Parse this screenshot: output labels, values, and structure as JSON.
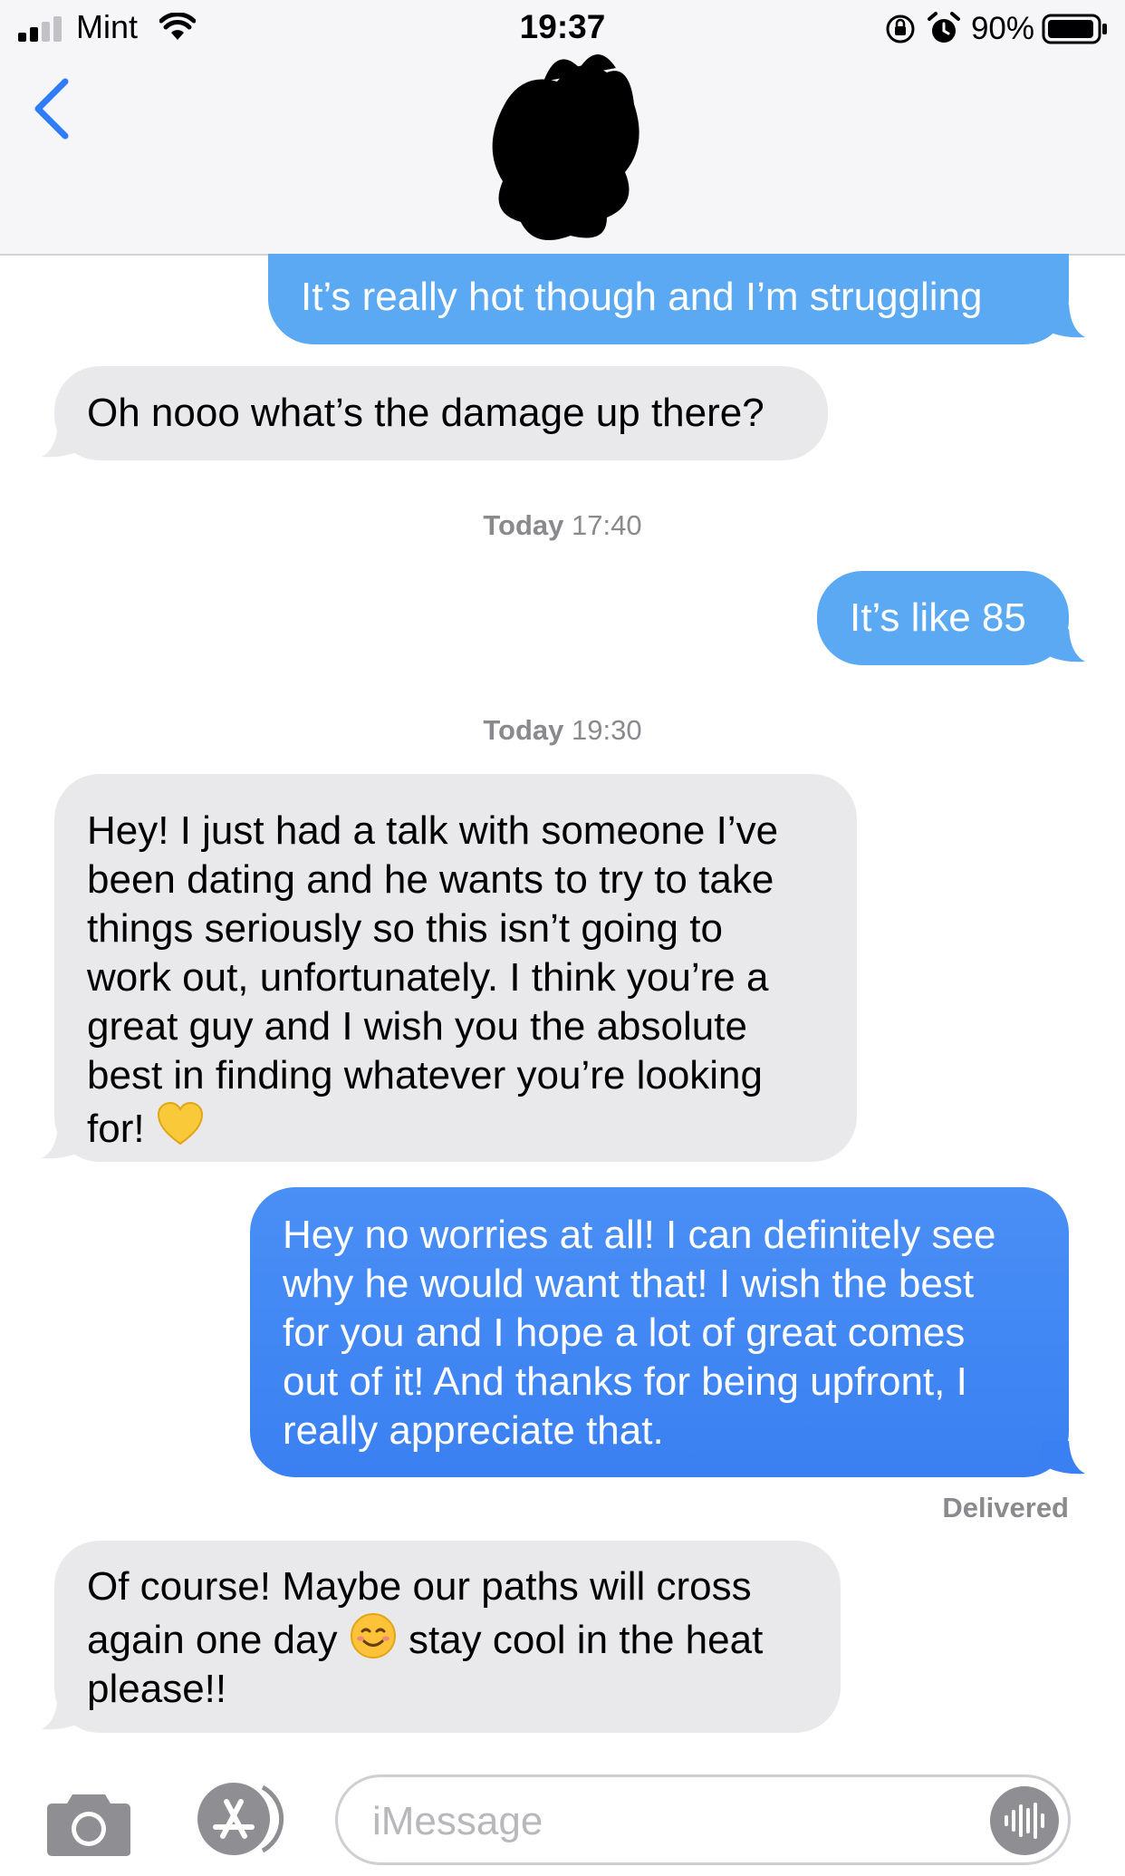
{
  "status_bar": {
    "carrier": "Mint",
    "time": "19:37",
    "battery_percent": "90%",
    "battery_level": 0.9,
    "signal_bars_active": 2,
    "signal_bars_total": 4
  },
  "header": {
    "back_icon": "chevron-left-icon",
    "contact": "redacted"
  },
  "messages": [
    {
      "side": "out",
      "text": "It’s really hot though and I’m struggling"
    },
    {
      "side": "in",
      "text": "Oh nooo what’s the damage up there?"
    },
    {
      "type": "timestamp",
      "day": "Today",
      "time": "17:40"
    },
    {
      "side": "out",
      "text": "It’s like 85"
    },
    {
      "type": "timestamp",
      "day": "Today",
      "time": "19:30"
    },
    {
      "side": "in",
      "lines": [
        "Hey! I just had a talk with someone I’ve",
        "been dating and he wants to try to take",
        "things seriously so this isn’t going to",
        "work out, unfortunately. I think you’re a",
        "great guy and I wish you the absolute",
        "best in finding whatever you’re looking",
        "for!"
      ],
      "emoji": "yellow-heart-emoji"
    },
    {
      "side": "out",
      "lines": [
        "Hey no worries at all! I can definitely see",
        "why he would want that! I wish the best",
        "for you and I hope a lot of great comes",
        "out of it! And thanks for being upfront, I",
        "really appreciate that."
      ]
    },
    {
      "type": "status",
      "text": "Delivered"
    },
    {
      "side": "in",
      "lines": [
        "Of course! Maybe our paths will cross",
        "again one day",
        "stay cool in the heat",
        "please!!"
      ],
      "emoji": "smiling-face-emoji"
    }
  ],
  "input_bar": {
    "placeholder": "iMessage",
    "value": "",
    "camera_icon": "camera-icon",
    "apps_icon": "app-store-icon",
    "audio_icon": "audio-waveform-icon"
  },
  "colors": {
    "outgoing_bubble": "#3a80f2",
    "outgoing_bubble_faded": "#5aa9f2",
    "incoming_bubble": "#e9e9eb",
    "accent": "#2f7cf6",
    "timestamp_text": "#8a8a8e"
  }
}
